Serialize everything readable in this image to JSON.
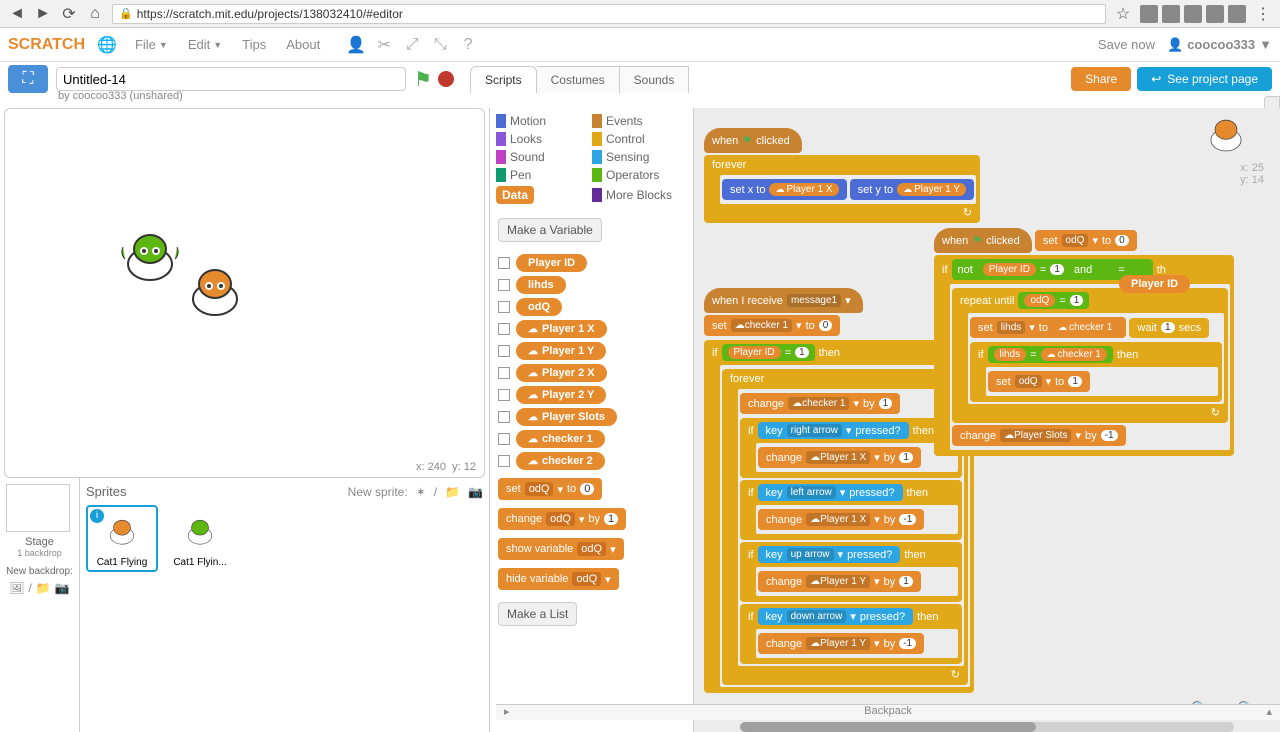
{
  "browser": {
    "url": "https://scratch.mit.edu/projects/138032410/#editor"
  },
  "menu": {
    "logo": "SCRATCH",
    "file": "File",
    "edit": "Edit",
    "tips": "Tips",
    "about": "About",
    "save": "Save now",
    "user": "coocoo333"
  },
  "project": {
    "title": "Untitled-14",
    "byline": "by coocoo333 (unshared)",
    "share": "Share",
    "see_page": "See project page"
  },
  "tabs": {
    "scripts": "Scripts",
    "costumes": "Costumes",
    "sounds": "Sounds"
  },
  "stage": {
    "x": "x: 240",
    "y": "y: 12"
  },
  "stage_panel": {
    "label": "Stage",
    "backdrop_count": "1 backdrop",
    "new_backdrop": "New backdrop:"
  },
  "sprites": {
    "title": "Sprites",
    "new_sprite": "New sprite:",
    "s1": "Cat1 Flying",
    "s2": "Cat1 Flyin..."
  },
  "categories": {
    "motion": "Motion",
    "looks": "Looks",
    "sound": "Sound",
    "pen": "Pen",
    "data": "Data",
    "events": "Events",
    "control": "Control",
    "sensing": "Sensing",
    "operators": "Operators",
    "more": "More Blocks"
  },
  "palette": {
    "make_var": "Make a Variable",
    "make_list": "Make a List",
    "vars": {
      "player_id": "Player ID",
      "lihds": "lihds",
      "odq": "odQ",
      "p1x": "Player 1 X",
      "p1y": "Player 1 Y",
      "p2x": "Player 2 X",
      "p2y": "Player 2 Y",
      "slots": "Player Slots",
      "chk1": "checker 1",
      "chk2": "checker 2"
    },
    "block_set": "set",
    "block_to": "to",
    "block_change": "change",
    "block_by": "by",
    "block_show": "show variable",
    "block_hide": "hide variable",
    "val0": "0",
    "val1": "1"
  },
  "scripts_area": {
    "when": "when",
    "clicked": "clicked",
    "forever": "forever",
    "setx": "set x to",
    "sety": "set y to",
    "receive": "when I receive",
    "msg": "message1",
    "set": "set",
    "to": "to",
    "if": "if",
    "then": "then",
    "change": "change",
    "by": "by",
    "key": "key",
    "pressed": "pressed?",
    "right": "right arrow",
    "left": "left arrow",
    "up": "up arrow",
    "down": "down arrow",
    "repeat_until": "repeat until",
    "wait": "wait",
    "secs": "secs",
    "not": "not",
    "and": "and",
    "eq": "=",
    "v0": "0",
    "v1": "1",
    "vn1": "-1",
    "player_id": "Player ID",
    "p1x": "Player 1 X",
    "p1y": "Player 1 Y",
    "chk1": "checker 1",
    "odq": "odQ",
    "lihds": "lihds",
    "slots": "Player Slots",
    "xlabel": "x: 25",
    "ylabel": "y: 14"
  },
  "backpack": "Backpack"
}
